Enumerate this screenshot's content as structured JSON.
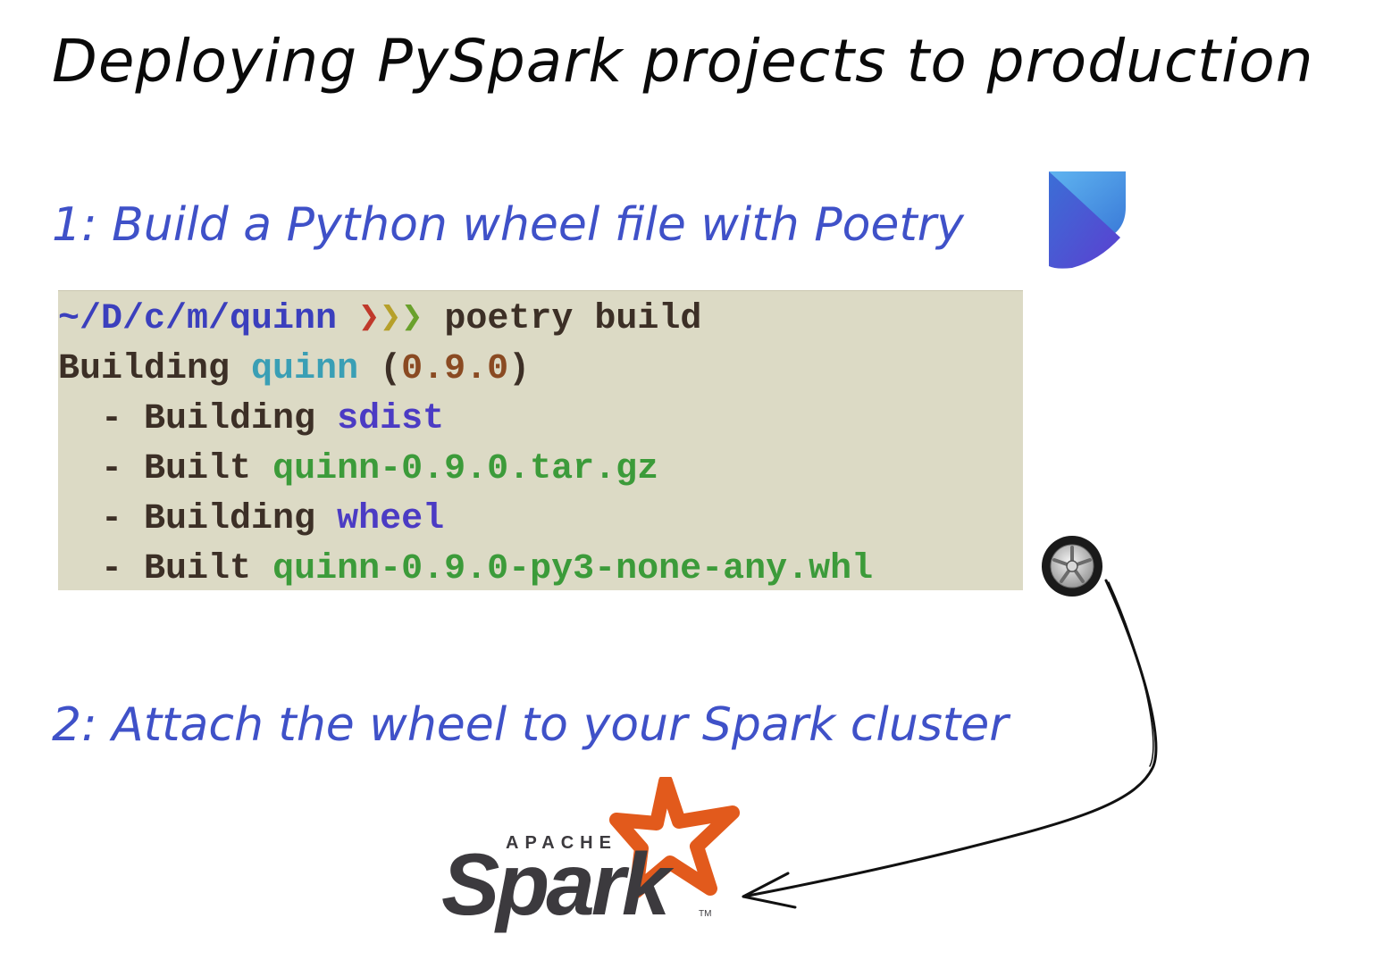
{
  "title": "Deploying PySpark projects to production",
  "step1": "1: Build a Python wheel file with Poetry",
  "step2": "2: Attach the wheel to your Spark cluster",
  "terminal": {
    "prompt_path": "~/D/c/m/quinn",
    "prompt_arrows": [
      "❯",
      "❯",
      "❯"
    ],
    "command": "poetry build",
    "building_label": "Building",
    "package_name": "quinn",
    "version_open": "(",
    "version": "0.9.0",
    "version_close": ")",
    "steps": [
      {
        "prefix": "  - ",
        "verb": "Building",
        "target": "sdist"
      },
      {
        "prefix": "  - ",
        "verb": "Built",
        "target": "quinn-0.9.0.tar.gz"
      },
      {
        "prefix": "  - ",
        "verb": "Building",
        "target": "wheel"
      },
      {
        "prefix": "  - ",
        "verb": "Built",
        "target": "quinn-0.9.0-py3-none-any.whl"
      }
    ]
  },
  "spark_logo": {
    "apache_text": "APACHE",
    "spark_text": "Spark",
    "tm_text": "TM"
  },
  "colors": {
    "step_text": "#3f51c8",
    "terminal_bg": "#dcdac5",
    "spark_star": "#e25a1c",
    "spark_text": "#3c3a3e"
  },
  "icons": [
    "poetry-logo-icon",
    "wheel-icon",
    "spark-star-icon"
  ]
}
